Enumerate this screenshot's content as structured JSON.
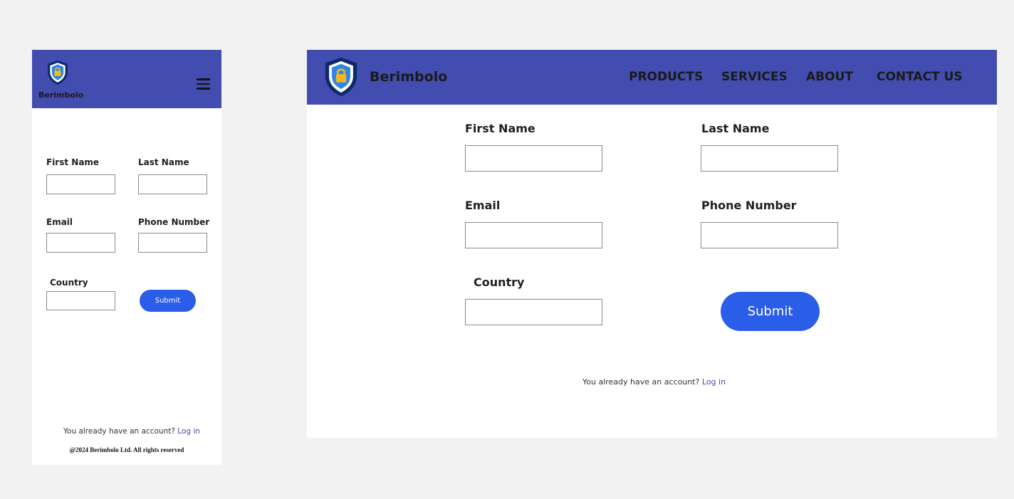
{
  "brand": {
    "name": "Berimbolo"
  },
  "nav": {
    "items": [
      {
        "label": "PRODUCTS"
      },
      {
        "label": "SERVICES"
      },
      {
        "label": "ABOUT"
      },
      {
        "label": "CONTACT US"
      }
    ]
  },
  "form": {
    "first_name_label": "First Name",
    "last_name_label": "Last Name",
    "email_label": "Email",
    "phone_label": "Phone Number",
    "country_label": "Country",
    "first_name_value": "",
    "last_name_value": "",
    "email_value": "",
    "phone_value": "",
    "country_value": "",
    "submit_label": "Submit"
  },
  "account": {
    "prompt": "You already have an account?",
    "login_link": "Log in"
  },
  "footer": {
    "copyright": "@2024 Berimbolo Ltd. All rights reserved"
  },
  "icons": {
    "logo": "shield-lock-icon",
    "menu": "hamburger-menu-icon"
  },
  "colors": {
    "header": "#434daf",
    "button": "#2b5ee8",
    "link": "#3d4aa8"
  }
}
